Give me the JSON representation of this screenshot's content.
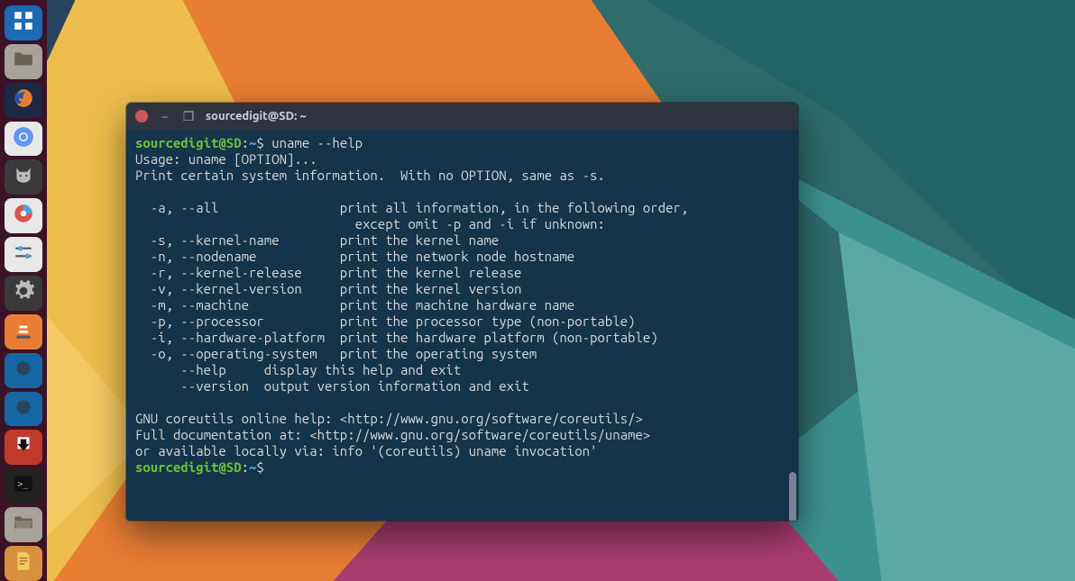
{
  "dock": {
    "items": [
      {
        "name": "show-applications",
        "icon": "grid"
      },
      {
        "name": "files",
        "icon": "folder"
      },
      {
        "name": "firefox",
        "icon": "firefox"
      },
      {
        "name": "chromium",
        "icon": "chromium"
      },
      {
        "name": "clipboard-cat",
        "icon": "cat"
      },
      {
        "name": "disk-usage",
        "icon": "disk"
      },
      {
        "name": "tweaks",
        "icon": "sliders"
      },
      {
        "name": "settings",
        "icon": "gear"
      },
      {
        "name": "vlc",
        "icon": "cone"
      },
      {
        "name": "app-blue-1",
        "icon": "circle"
      },
      {
        "name": "app-blue-2",
        "icon": "circle"
      },
      {
        "name": "transmission",
        "icon": "arrow-down"
      },
      {
        "name": "terminal",
        "icon": "terminal"
      },
      {
        "name": "folder-open",
        "icon": "folder"
      },
      {
        "name": "document",
        "icon": "doc"
      }
    ]
  },
  "terminal": {
    "title": "sourcedigit@SD: ~",
    "prompt": {
      "user_host": "sourcedigit@SD",
      "colon": ":",
      "path": "~",
      "dollar": "$"
    },
    "command": "uname --help",
    "output_lines": [
      "Usage: uname [OPTION]...",
      "Print certain system information.  With no OPTION, same as -s.",
      "",
      "  -a, --all                print all information, in the following order,",
      "                             except omit -p and -i if unknown:",
      "  -s, --kernel-name        print the kernel name",
      "  -n, --nodename           print the network node hostname",
      "  -r, --kernel-release     print the kernel release",
      "  -v, --kernel-version     print the kernel version",
      "  -m, --machine            print the machine hardware name",
      "  -p, --processor          print the processor type (non-portable)",
      "  -i, --hardware-platform  print the hardware platform (non-portable)",
      "  -o, --operating-system   print the operating system",
      "      --help     display this help and exit",
      "      --version  output version information and exit",
      "",
      "GNU coreutils online help: <http://www.gnu.org/software/coreutils/>",
      "Full documentation at: <http://www.gnu.org/software/coreutils/uname>",
      "or available locally via: info '(coreutils) uname invocation'"
    ],
    "titlebar_minimize": "–",
    "titlebar_maximize": "❐"
  }
}
